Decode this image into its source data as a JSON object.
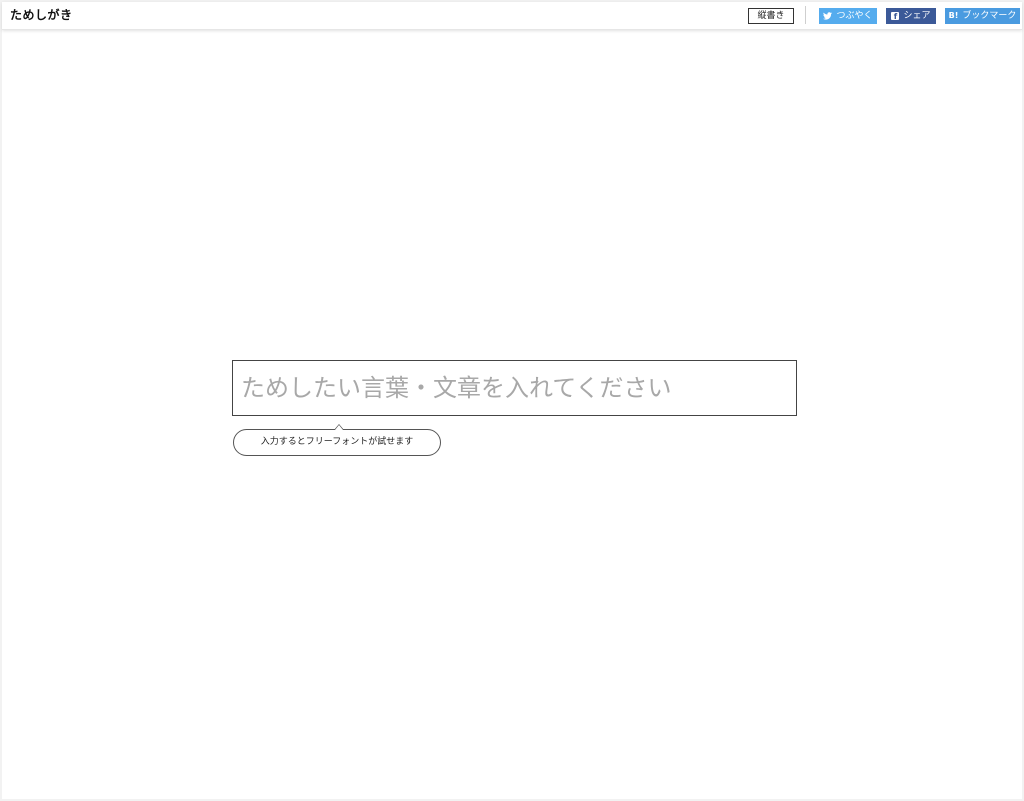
{
  "header": {
    "logo": "ためしがき",
    "vertical_label": "縦書き",
    "tweet_label": "つぶやく",
    "share_label": "シェア",
    "bookmark_label": "ブックマーク",
    "bookmark_icon_text": "B!",
    "share_icon_text": "f"
  },
  "main": {
    "input": {
      "placeholder": "ためしたい言葉・文章を入れてください",
      "value": ""
    },
    "hint": "入力するとフリーフォントが試せます"
  },
  "colors": {
    "tweet": "#55acee",
    "facebook": "#3b5998",
    "hatena": "#4a9be0"
  },
  "icons": {
    "tweet": "twitter-bird-icon",
    "share": "facebook-icon",
    "bookmark": "hatena-bookmark-icon"
  }
}
